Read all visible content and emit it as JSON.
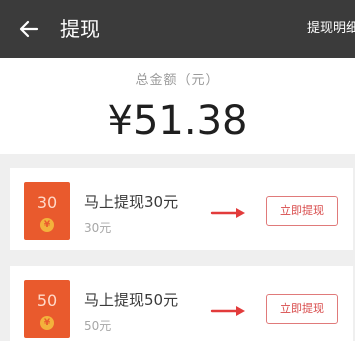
{
  "header": {
    "title": "提现",
    "link_label": "提现明细"
  },
  "summary": {
    "label": "总金额（元）",
    "amount": "¥51.38"
  },
  "offers": [
    {
      "coupon_value": "30",
      "title": "马上提现30元",
      "subtitle": "30元",
      "button_label": "立即提现"
    },
    {
      "coupon_value": "50",
      "title": "马上提现50元",
      "subtitle": "50元",
      "button_label": "立即提现"
    }
  ],
  "colors": {
    "header_bg": "#3b3b3b",
    "coupon_bg": "#e95a2d",
    "accent_red": "#d84a4a",
    "page_bg": "#efefef"
  },
  "icons": {
    "back": "back-arrow-icon",
    "coupon_badge": "yen-coin-icon",
    "pointer": "red-arrow-icon"
  }
}
